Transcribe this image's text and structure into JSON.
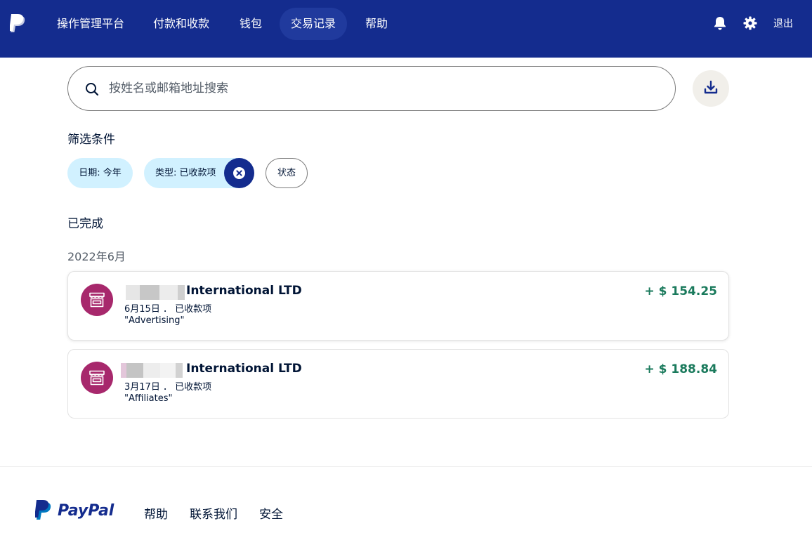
{
  "header": {
    "nav": [
      {
        "label": "操作管理平台"
      },
      {
        "label": "付款和收款"
      },
      {
        "label": "钱包"
      },
      {
        "label": "交易记录"
      },
      {
        "label": "帮助"
      }
    ],
    "active_nav": "交易记录",
    "logout_label": "退出",
    "icons": [
      "paypal-logo-icon",
      "bell-icon",
      "gear-icon"
    ]
  },
  "search": {
    "placeholder": "按姓名或邮箱地址搜索"
  },
  "filters": {
    "title": "筛选条件",
    "chips": [
      {
        "label": "日期: 今年"
      },
      {
        "label": "类型: 已收款项"
      },
      {
        "label": "状态"
      }
    ]
  },
  "section": {
    "title": "已完成",
    "month": "2022年6月"
  },
  "transactions": [
    {
      "name": "International LTD",
      "meta": "6月15日 ． 已收款项",
      "note": "\"Advertising\"",
      "amount": "+ $ 154.25"
    },
    {
      "name": "International LTD",
      "meta": "3月17日 ． 已收款项",
      "note": "\"Affiliates\"",
      "amount": "+ $ 188.84"
    }
  ],
  "footer": {
    "brand": "PayPal",
    "links": [
      {
        "label": "帮助"
      },
      {
        "label": "联系我们"
      },
      {
        "label": "安全"
      }
    ]
  },
  "colors": {
    "header_bg": "#142c8e",
    "chip_bg": "#d1f1ff",
    "amount_positive": "#1a7a5c",
    "avatar_bg": "#a7286c"
  }
}
